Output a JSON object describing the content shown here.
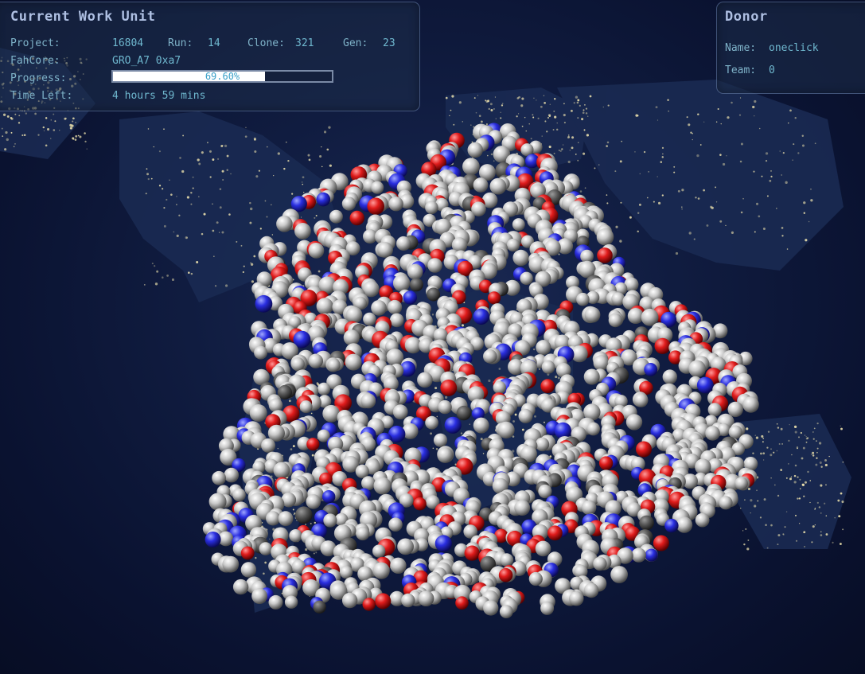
{
  "work_unit": {
    "title": "Current Work Unit",
    "project_label": "Project:",
    "project_value": "16804",
    "run_label": "Run:",
    "run_value": "14",
    "clone_label": "Clone:",
    "clone_value": "321",
    "gen_label": "Gen:",
    "gen_value": "23",
    "fahcore_label": "FahCore:",
    "fahcore_value": "GRO_A7 0xa7",
    "progress_label": "Progress:",
    "progress_text": "69.60%",
    "progress_fraction": 0.696,
    "time_left_label": "Time Left:",
    "time_left_value": "4 hours 59 mins"
  },
  "donor": {
    "title": "Donor",
    "name_label": "Name:",
    "name_value": "oneclick",
    "team_label": "Team:",
    "team_value": "0"
  },
  "colors": {
    "carbon": "#c8c8c8",
    "carbon_dark": "#555555",
    "oxygen": "#e01c1c",
    "nitrogen": "#2a2ee0",
    "panel_text": "#7fb3c9",
    "panel_title": "#aebfe2"
  }
}
